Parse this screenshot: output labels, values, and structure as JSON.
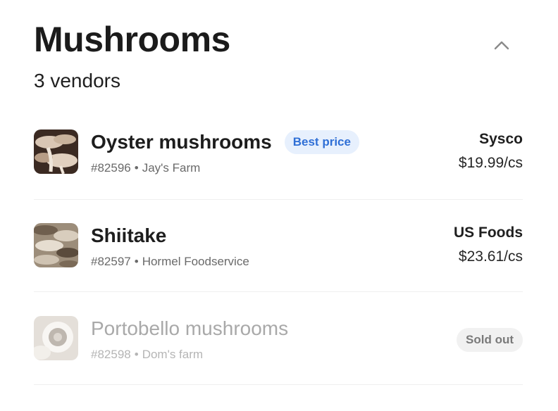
{
  "header": {
    "title": "Mushrooms",
    "subtitle": "3 vendors"
  },
  "items": [
    {
      "name": "Oyster mushrooms",
      "badge": "Best price",
      "sku": "#82596",
      "farm": "Jay's Farm",
      "vendor": "Sysco",
      "price": "$19.99/cs",
      "thumb_icon": "oyster-mushroom-photo",
      "available": true
    },
    {
      "name": "Shiitake",
      "sku": "#82597",
      "farm": "Hormel Foodservice",
      "vendor": "US Foods",
      "price": "$23.61/cs",
      "thumb_icon": "shiitake-mushroom-photo",
      "available": true
    },
    {
      "name": "Portobello mushrooms",
      "sku": "#82598",
      "farm": "Dom's farm",
      "status": "Sold out",
      "thumb_icon": "portobello-mushroom-photo",
      "available": false
    }
  ],
  "meta_separator": "•",
  "colors": {
    "badge_text": "#2f6fd6",
    "badge_bg": "#e7f0fd",
    "soldout_bg": "#f1f1f1"
  }
}
